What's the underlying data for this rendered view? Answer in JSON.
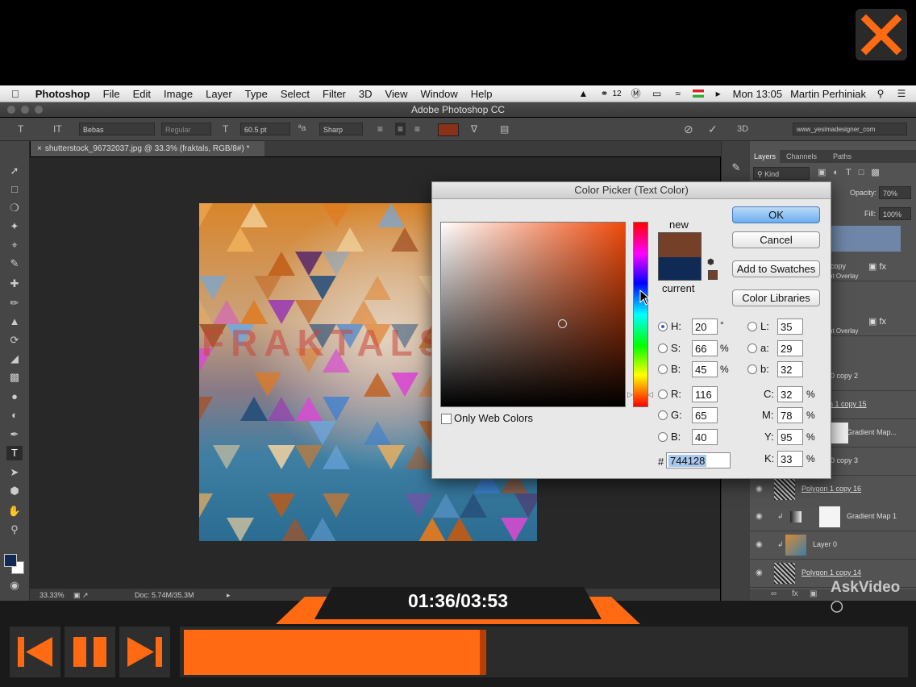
{
  "menubar": {
    "app": "Photoshop",
    "items": [
      "File",
      "Edit",
      "Image",
      "Layer",
      "Type",
      "Select",
      "Filter",
      "3D",
      "View",
      "Window",
      "Help"
    ],
    "badge": "12",
    "clock": "Mon 13:05",
    "user": "Martin Perhiniak"
  },
  "ps_title": "Adobe Photoshop CC",
  "options": {
    "font_family": "Bebas",
    "font_style": "Regular",
    "font_size": "60.5 pt",
    "aa_label": "ªa",
    "antialias": "Sharp",
    "three_d": "3D",
    "workspace": "www_yesimadesigner_com"
  },
  "doc_tab": "shutterstock_96732037.jpg @ 33.3% (fraktals, RGB/8#) *",
  "status": {
    "zoom": "33.33%",
    "doc": "Doc: 5.74M/35.3M"
  },
  "panel": {
    "tabs": [
      "Layers",
      "Channels",
      "Paths"
    ],
    "kind": "Kind",
    "opacity_label": "Opacity:",
    "opacity": "70%",
    "fill_label": "Fill:",
    "fill": "100%",
    "layers": [
      "copy",
      "nt Overlay",
      "nt Overlay",
      "0 copy 2",
      "n 1 copy 15",
      "Gradient Map...",
      "0 copy 3",
      "Polygon 1 copy 16",
      "Gradient Map 1",
      "Layer 0",
      "Polygon 1 copy 14"
    ]
  },
  "picker": {
    "title": "Color Picker (Text Color)",
    "new_label": "new",
    "current_label": "current",
    "new_color": "#744128",
    "current_color": "#0e2a55",
    "ok": "OK",
    "cancel": "Cancel",
    "add_swatches": "Add to Swatches",
    "color_libraries": "Color Libraries",
    "only_web": "Only Web Colors",
    "H": "20",
    "S": "66",
    "B": "45",
    "R": "116",
    "G": "65",
    "Bl": "40",
    "L": "35",
    "a": "29",
    "b": "32",
    "C": "32",
    "M": "78",
    "Y": "95",
    "K": "33",
    "hex": "744128",
    "labels": {
      "H": "H:",
      "S": "S:",
      "B": "B:",
      "R": "R:",
      "G": "G:",
      "Bl": "B:",
      "L": "L:",
      "a": "a:",
      "b": "b:",
      "C": "C:",
      "M": "M:",
      "Y": "Y:",
      "K": "K:",
      "hash": "#"
    },
    "units": {
      "deg": "°",
      "pct": "%"
    }
  },
  "artwork_text": "FRAKTALS",
  "player": {
    "time": "01:36/03:53",
    "progress": 0.42,
    "watermark": "AskVideo"
  },
  "colors": {
    "accent": "#ff6a13",
    "ps_bg": "#282828"
  }
}
